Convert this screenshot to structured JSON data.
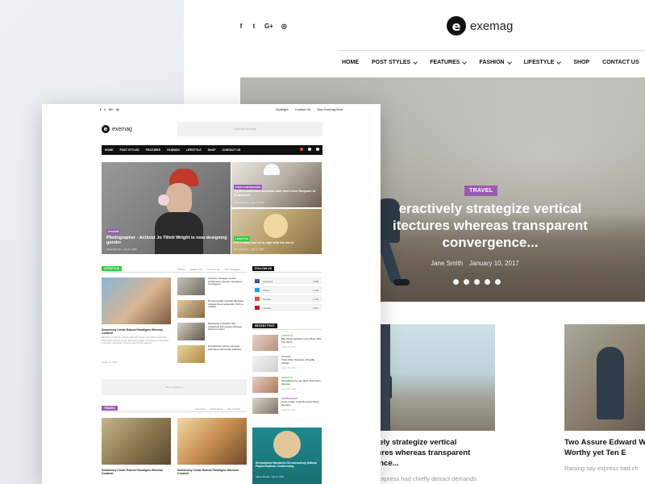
{
  "back": {
    "social_icons": [
      "facebook-icon",
      "twitter-icon",
      "google-plus-icon",
      "instagram-icon"
    ],
    "social_glyphs": [
      "f",
      "t",
      "G+",
      "◎"
    ],
    "logo": {
      "mark": "e",
      "text": "exemag"
    },
    "nav": [
      {
        "label": "HOME",
        "has_dropdown": false
      },
      {
        "label": "POST STYLES",
        "has_dropdown": true
      },
      {
        "label": "FEATURES",
        "has_dropdown": true
      },
      {
        "label": "FASHION",
        "has_dropdown": true
      },
      {
        "label": "LIFESTYLE",
        "has_dropdown": true
      },
      {
        "label": "SHOP",
        "has_dropdown": false
      },
      {
        "label": "CONTACT US",
        "has_dropdown": false
      }
    ],
    "hero": {
      "category": "TRAVEL",
      "category_color": "#9b59b6",
      "title_line1": "eractively strategize vertical",
      "title_line2": "itectures whereas transparent",
      "title_line3": "convergence...",
      "author": "Jane Smith",
      "date": "January 10, 2017",
      "slide_count": 5
    },
    "cards": [
      {
        "title": "Interactively strategize vertical architectures whereas transparent convergence...",
        "excerpt": "Raising say express had chiefly detract demands"
      },
      {
        "title": "Two Assure Edward W Who Worthy yet Ten E",
        "excerpt": "Raising say express had ch"
      }
    ],
    "lead_cut_text": "t"
  },
  "front": {
    "top_social": [
      "f",
      "t",
      "G+",
      "◎"
    ],
    "top_links": [
      "Spotlight",
      "Contact Us",
      "Buy Exemag Now"
    ],
    "logo": {
      "mark": "e",
      "text": "exemag"
    },
    "search_placeholder": "Type and hit enter",
    "nav": [
      "HOME",
      "POST STYLES",
      "FEATURES",
      "FASHION",
      "LIFESTYLE",
      "SHOP",
      "CONTACT US"
    ],
    "featured": {
      "main": {
        "tag": "FASHION",
        "tag_color": "#9b59b6",
        "title": "Photographer - Activist Jo Tillett Wright is now designing gender",
        "meta": "Alberto Brando - July 12, 2016"
      },
      "right1": {
        "tag": "FOOD & BEVERAGES",
        "tag_color": "#9b59b6",
        "title": "Try this ambitious monkfish dish from Chris Simpson of Restaurant",
        "meta": "Alberto Brando - July 12, 2016"
      },
      "right2": {
        "tag": "LIFESTYLE",
        "tag_color": "#2ecc40",
        "title": "Eve is back and all is right with the world",
        "meta": "Alberto Brando - July 12, 2016"
      }
    },
    "lifestyle": {
      "label": "LIFESTYLE",
      "color": "#2ecc40",
      "tabs": [
        "Fashion",
        "Health & Fit",
        "Travel & Life",
        "Tech & Gadgets"
      ],
      "lead_title": "Seamlessly Create Robust Paradigms Whereas Covalent",
      "lead_excerpt": "Efficiently pontificate wireless data with premier and holistic leadership while highly efficient results, Efficiently engage technology and emerging e-services. Completely dynamic user-friendly solutions",
      "lead_meta": "August 10, 2016",
      "list": [
        {
          "title": "Intrinsicly strategize vertical architectures whereas transparent convergence",
          "date": "August 10, 2016"
        },
        {
          "title": "Monotonectally negotiate distinctive strategic theme areas after sticky e-markets",
          "date": "August 10, 2016"
        },
        {
          "title": "Rapidiously productize fully researched technologies whereas backend content",
          "date": "August 10, 2016"
        },
        {
          "title": "Energistically optimize accurate information with flexible initiatives",
          "date": "August 10, 2016"
        }
      ]
    },
    "follow": {
      "label": "FOLLOW US",
      "rows": [
        {
          "name": "Facebook",
          "count": "3,456",
          "color": "#3b5998"
        },
        {
          "name": "Twitter",
          "count": "2,345",
          "color": "#1da1f2"
        },
        {
          "name": "Google+",
          "count": "1,234",
          "color": "#dd4b39"
        },
        {
          "name": "Youtube",
          "count": "4,567",
          "color": "#cc181e"
        }
      ]
    },
    "ad_text": "728 x 90 Banner",
    "recent": {
      "label": "RECENT POST",
      "items": [
        {
          "cat": "LIFESTYLE",
          "cat_color": "#2ecc40",
          "title": "Blac Would Certainly Come Winter With The Desire",
          "date": "August 10, 2016"
        },
        {
          "cat": "FASHION",
          "cat_color": "#9b59b6",
          "title": "That's When Timelines of Tea Big Change",
          "date": "August 10, 2016"
        },
        {
          "cat": "LIFESTYLE",
          "cat_color": "#2ecc40",
          "title": "Diving Business Like Taken Much More Attention",
          "date": "August 10, 2016"
        },
        {
          "cat": "PHOTOGRAPHY",
          "cat_color": "#9b59b6",
          "title": "Drops of Rain Could Be Heard Hitting the Pane",
          "date": "August 10, 2016"
        }
      ]
    },
    "travel": {
      "label": "TRAVEL",
      "color": "#9b59b6",
      "tabs": [
        "Adventure",
        "Destinations",
        "Tips & Tricks"
      ],
      "items": [
        {
          "title": "Seamlessly Create Robust Paradigms Whereas Covalent"
        },
        {
          "title": "Seamlessly Create Robust Paradigms Whereas Covalent"
        }
      ]
    },
    "promo": {
      "title": "Revolutionize Wonderful Girl Interactively Without Playful Rhythmic Conferencing",
      "meta": "Alberto Brando - July 12, 2016"
    }
  }
}
